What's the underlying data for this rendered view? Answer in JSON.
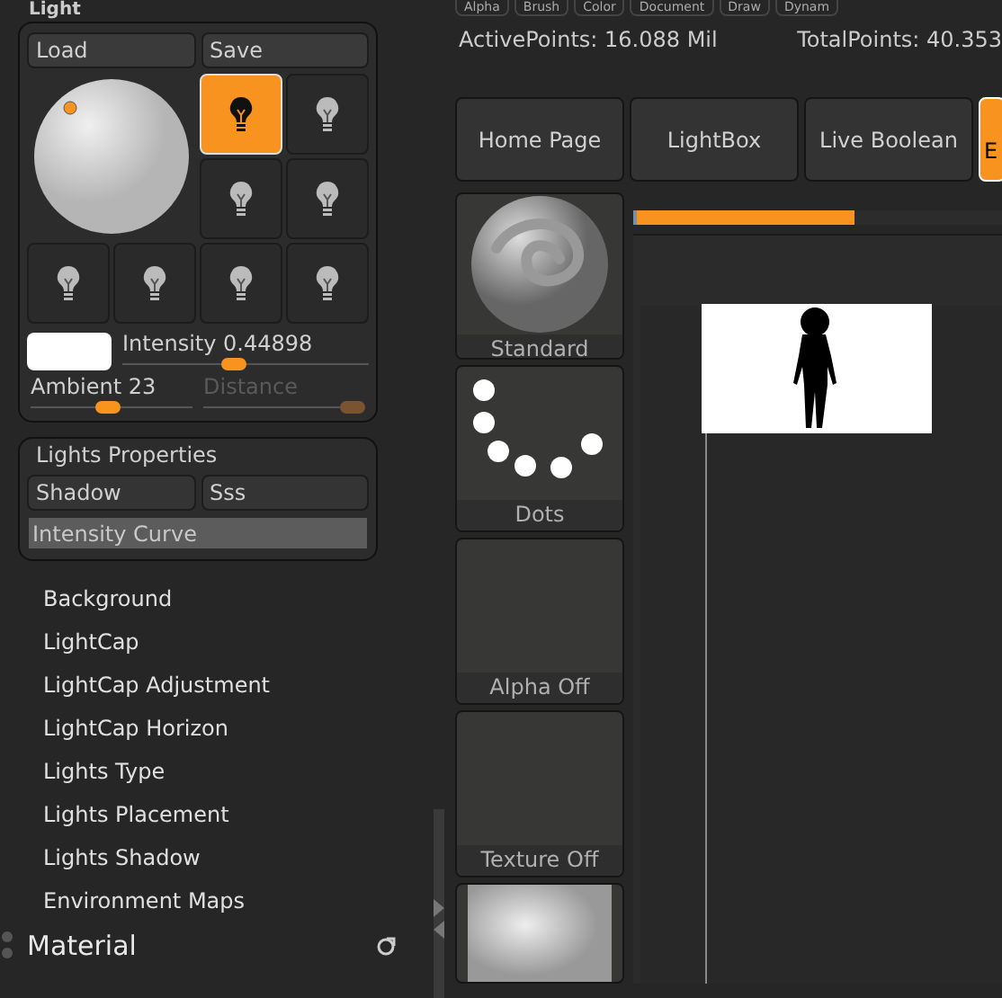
{
  "top_menu": [
    "Alpha",
    "Brush",
    "Color",
    "Document",
    "Draw",
    "Dynam"
  ],
  "light_panel": {
    "title": "Light",
    "buttons": [
      "Load",
      "Save"
    ],
    "lights": [
      {
        "selected": true
      },
      {
        "selected": false
      },
      {
        "selected": false
      },
      {
        "selected": false
      },
      {
        "selected": false
      },
      {
        "selected": false
      },
      {
        "selected": false
      },
      {
        "selected": false
      }
    ],
    "sliders": [
      {
        "label": "Intensity",
        "reading": "0.44898",
        "level": 0.45,
        "disabled": false
      },
      {
        "label": "Ambient",
        "reading": "23",
        "level": 0.47,
        "disabled": false
      },
      {
        "label": "Distance",
        "level": 1,
        "disabled": true
      }
    ]
  },
  "lights_properties": {
    "title": "Lights Properties",
    "buttons": [
      "Shadow",
      "Sss"
    ],
    "curve": "Intensity Curve"
  },
  "sub_menus": [
    "Background",
    "LightCap",
    "LightCap Adjustment",
    "LightCap Horizon",
    "Lights Type",
    "Lights Placement",
    "Lights Shadow",
    "Environment Maps"
  ],
  "material_header": "Material",
  "progress": {
    "level": 0.6
  },
  "stats": {
    "active": "ActivePoints: 16.088 Mil",
    "total": "TotalPoints: 40.353"
  },
  "tabs": [
    {
      "label": "Home Page",
      "selected": false
    },
    {
      "label": "LightBox",
      "selected": false
    },
    {
      "label": "Live Boolean",
      "selected": false
    },
    {
      "label": "E",
      "selected": true
    }
  ],
  "shelf": [
    {
      "kind": "brush",
      "label": "Standard"
    },
    {
      "kind": "stroke",
      "label": "Dots"
    },
    {
      "kind": "empty",
      "label": "Alpha Off"
    },
    {
      "kind": "empty",
      "label": "Texture Off"
    },
    {
      "kind": "material"
    }
  ]
}
